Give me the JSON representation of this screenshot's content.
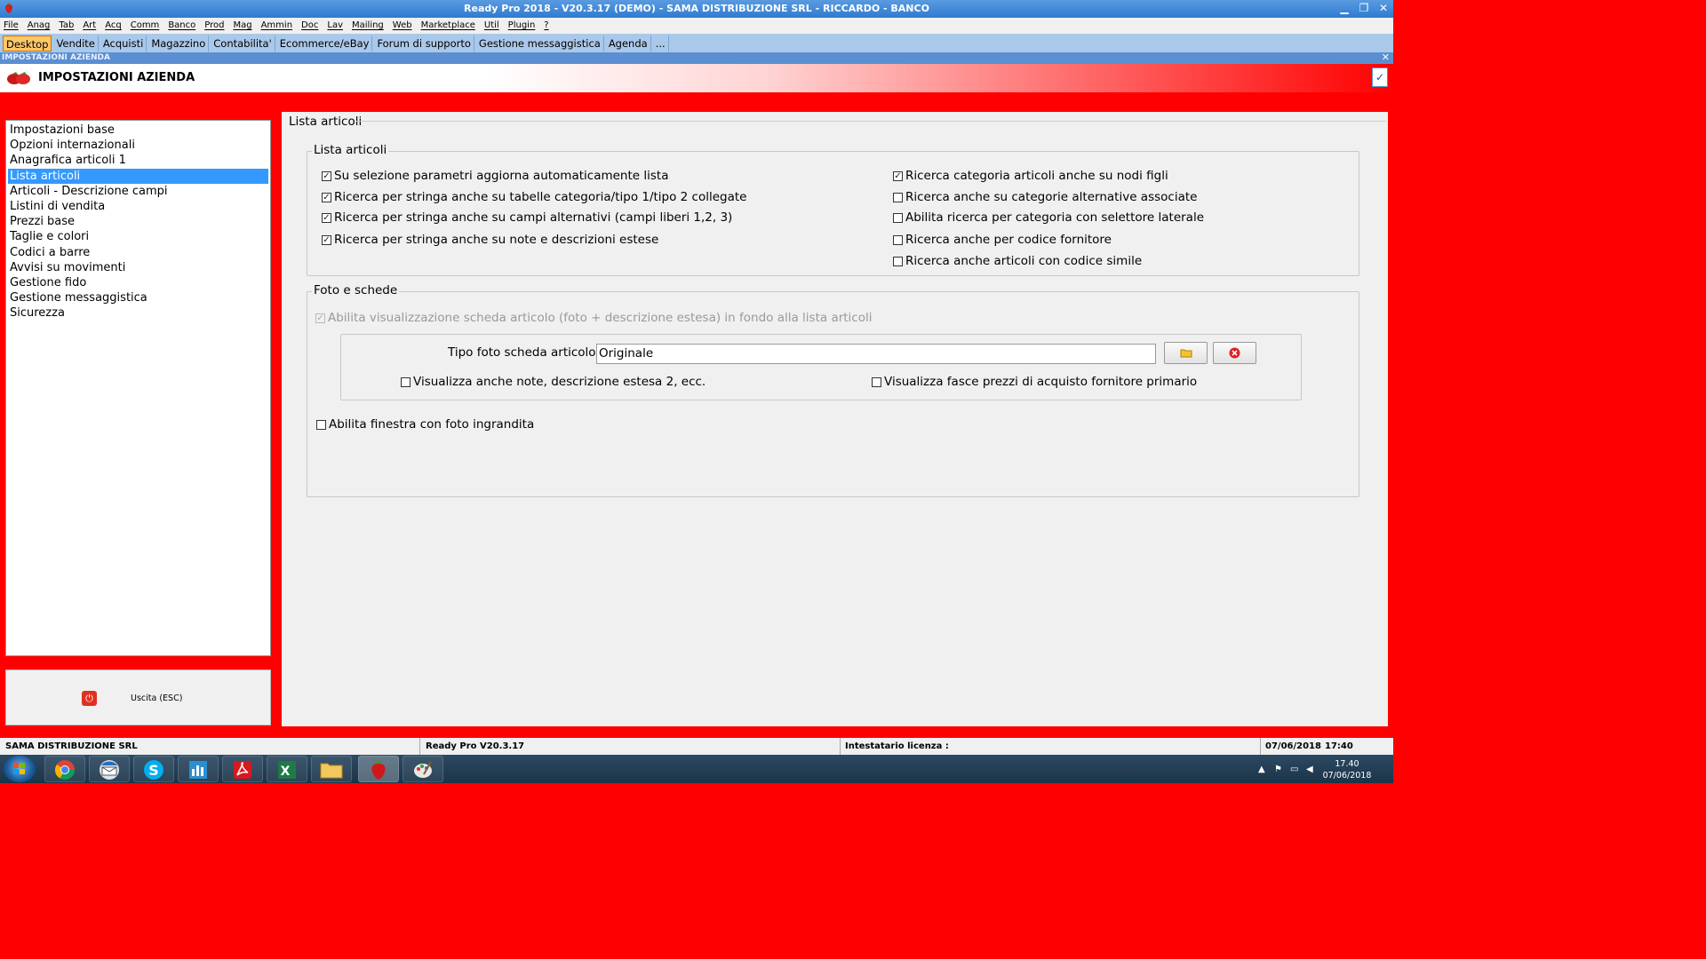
{
  "window": {
    "title": "Ready Pro 2018 - V20.3.17 (DEMO) - SAMA DISTRIBUZIONE SRL - RICCARDO - BANCO",
    "minimize_icon": "minimize-icon",
    "restore_icon": "restore-icon",
    "close_icon": "close-icon"
  },
  "menu": [
    "File",
    "Anag",
    "Tab",
    "Art",
    "Acq",
    "Comm",
    "Banco",
    "Prod",
    "Mag",
    "Ammin",
    "Doc",
    "Lav",
    "Mailing",
    "Web",
    "Marketplace",
    "Util",
    "Plugin",
    "?"
  ],
  "tabs": [
    "Desktop",
    "Vendite",
    "Acquisti",
    "Magazzino",
    "Contabilita'",
    "Ecommerce/eBay",
    "Forum di supporto",
    "Gestione messaggistica",
    "Agenda",
    "..."
  ],
  "active_tab": "Desktop",
  "subheader": {
    "title": "IMPOSTAZIONI AZIENDA",
    "close": "✕"
  },
  "header": {
    "title": "IMPOSTAZIONI AZIENDA",
    "check_icon": "✓"
  },
  "sidebar": {
    "items": [
      "Impostazioni base",
      "Opzioni internazionali",
      "Anagrafica articoli 1",
      "Lista articoli",
      "Articoli - Descrizione campi",
      "Listini di vendita",
      "Prezzi base",
      "Taglie e colori",
      "Codici a barre",
      "Avvisi su movimenti",
      "Gestione fido",
      "Gestione messaggistica",
      "Sicurezza"
    ],
    "selected": "Lista articoli",
    "exit_label": "Uscita (ESC)",
    "exit_icon": "⏻"
  },
  "panel": {
    "title": "Lista articoli",
    "group1": {
      "label": "Lista articoli",
      "left": [
        {
          "label": "Su selezione parametri aggiorna automaticamente lista",
          "checked": true
        },
        {
          "label": "Ricerca per stringa anche su tabelle categoria/tipo 1/tipo 2 collegate",
          "checked": true
        },
        {
          "label": "Ricerca per stringa anche su campi alternativi (campi liberi 1,2, 3)",
          "checked": true
        },
        {
          "label": "Ricerca per stringa anche su note e descrizioni estese",
          "checked": true
        }
      ],
      "right": [
        {
          "label": "Ricerca categoria articoli anche su nodi figli",
          "checked": true
        },
        {
          "label": "Ricerca anche su categorie alternative associate",
          "checked": false
        },
        {
          "label": "Abilita ricerca per categoria con selettore laterale",
          "checked": false
        },
        {
          "label": "Ricerca anche per codice fornitore",
          "checked": false
        },
        {
          "label": "Ricerca anche articoli con codice simile",
          "checked": false
        }
      ]
    },
    "group2": {
      "label": "Foto e schede",
      "enable_card": {
        "label": "Abilita visualizzazione scheda articolo (foto + descrizione estesa) in fondo alla lista articoli",
        "checked": true,
        "disabled": true
      },
      "photo_type_label": "Tipo foto scheda articolo :",
      "photo_type_value": "Originale",
      "show_notes": {
        "label": "Visualizza anche note, descrizione estesa 2, ecc.",
        "checked": false
      },
      "show_price_bands": {
        "label": "Visualizza fasce prezzi di acquisto fornitore primario",
        "checked": false
      },
      "enlarged_photo": {
        "label": "Abilita finestra con foto ingrandita",
        "checked": false
      }
    }
  },
  "statusbar": {
    "company": "SAMA DISTRIBUZIONE SRL",
    "version": "Ready Pro V20.3.17",
    "license": "Intestatario licenza :",
    "date": "07/06/2018",
    "time": "17:40"
  },
  "taskbar": {
    "clock_time": "17.40",
    "clock_date": "07/06/2018",
    "apps": [
      "chrome-icon",
      "thunderbird-icon",
      "skype-icon",
      "chart-app-icon",
      "acrobat-icon",
      "excel-icon",
      "explorer-icon",
      "readypro-icon",
      "paint-icon"
    ]
  }
}
